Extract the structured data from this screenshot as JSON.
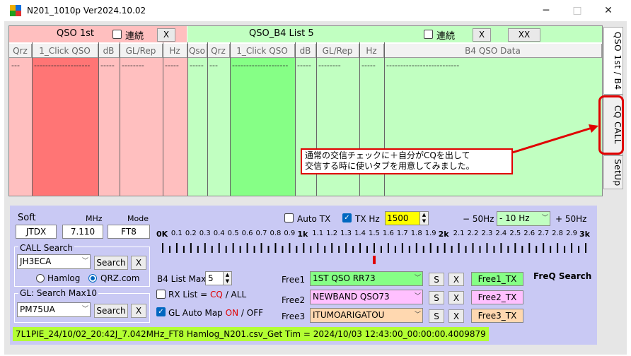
{
  "window": {
    "title": "N201_1010p   Ver2024.10.02",
    "minimize": "─",
    "maximize": "□",
    "close": "✕"
  },
  "qso1st": {
    "title": "QSO  1st",
    "renzoku": "連続",
    "x": "X",
    "columns": [
      "Qrz",
      "1_Click QSO",
      "dB",
      "GL/Rep",
      "Hz"
    ],
    "dashes": [
      "---",
      "--------------------",
      "-----",
      "--------",
      "-----"
    ]
  },
  "qsob4": {
    "title": "QSO_B4   List  5",
    "renzoku": "連続",
    "x": "X",
    "xx": "XX",
    "columns": [
      "Qso",
      "Qrz",
      "1_Click QSO",
      "dB",
      "GL/Rep",
      "Hz",
      "B4 QSO Data"
    ],
    "dashes": [
      "-----",
      "---",
      "--------------------",
      "-----",
      "--------",
      "-----",
      "--------------------------"
    ]
  },
  "tabs": {
    "qso": "QSO 1st / B4",
    "cq": "CQ  CALL",
    "setup": "SetUp"
  },
  "annotation": {
    "line1": "通常の交信チェックに＋自分がCQを出して",
    "line2": "交信する時に使いタブを用意してみました。"
  },
  "controls": {
    "soft_label": "Soft",
    "mhz_label": "MHz",
    "mode_label": "Mode",
    "soft": "JTDX",
    "mhz": "7.110",
    "mode": "FT8",
    "call_search_label": "CALL Search",
    "call_value": "JH3ECA",
    "search": "Search",
    "x": "X",
    "hamlog": "Hamlog",
    "qrz": "QRZ.com",
    "gl_search_label": "GL:  Search Max10",
    "gl_value": "PM75UA",
    "auto_tx": "Auto TX",
    "tx_hz": "TX Hz",
    "tx_hz_value": "1500",
    "minus50": "− 50Hz",
    "hz_select": "- 10 Hz",
    "plus50": "+ 50Hz",
    "scale_labels": [
      "0K",
      "0.1",
      "0.2",
      "0.3",
      "0.4",
      "0.5",
      "0.6",
      "0.7",
      "0.8",
      "0.9",
      "1k",
      "1.1",
      "1.2",
      "1.3",
      "1.4",
      "1.5",
      "1.6",
      "1.7",
      "1.8",
      "1.9",
      "2k",
      "2.1",
      "2.2",
      "2.3",
      "2.4",
      "2.5",
      "2.6",
      "2.7",
      "2.8",
      "2.9",
      "3k"
    ],
    "b4_list_max": "B4 List Max",
    "b4_value": "5",
    "rx_list": "RX List =",
    "cq": "CQ",
    "slash_all": "/ ALL",
    "gl_auto_map": "GL Auto Map",
    "on": "ON",
    "slash_off": "/ OFF",
    "free1_label": "Free1",
    "free1_value": "1ST QSO RR73",
    "free1_tx": "Free1_TX",
    "free2_label": "Free2",
    "free2_value": "NEWBAND QSO73",
    "free2_tx": "Free2_TX",
    "free3_label": "Free3",
    "free3_value": "ITUMOARIGATOU",
    "free3_tx": "Free3_TX",
    "s": "S",
    "freq_search": "FreQ Search"
  },
  "status": {
    "text": "7L1PIE_24/10/02_20:42J_7.042MHz_FT8          Hamlog_N201.csv_Get Tim = 2024/10/03 12:43:00_00:00:00.4009879"
  },
  "colors": {
    "pink": "#ffbfbf",
    "red_col": "#ff7575",
    "green": "#c1ffc1",
    "green_col": "#86ff86",
    "panel": "#c9c9f4"
  }
}
